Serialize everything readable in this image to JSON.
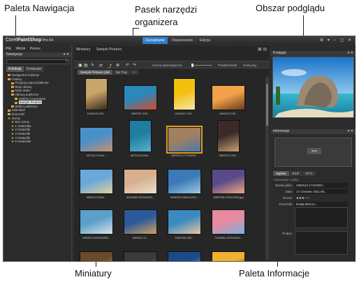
{
  "callouts": {
    "navigation": "Paleta Nawigacja",
    "toolbar_l1": "Pasek narzędzi",
    "toolbar_l2": "organizera",
    "preview": "Obszar podglądu",
    "thumbnails": "Miniatury",
    "info": "Paleta Informacje"
  },
  "app": {
    "title_prefix": "Corel",
    "title_main": "PaintShop",
    "title_suffix": " Pro X4",
    "modes": [
      "Zarządzanie",
      "Dopasowanie",
      "Edycja"
    ],
    "active_mode": "Zarządzanie"
  },
  "left_panel": {
    "menu": [
      "Plik",
      "Widok",
      "Pomoc"
    ],
    "header": "Nawigacja",
    "tabs": [
      "Kolekcje",
      "Komputer"
    ],
    "tree": [
      {
        "label": "Inteligentne kolekcje",
        "indent": 1,
        "icon": "folder"
      },
      {
        "label": "Foldery",
        "indent": 1,
        "icon": "folder"
      },
      {
        "label": "Przejrzyj więcej folderów",
        "indent": 2,
        "icon": "folder"
      },
      {
        "label": "Moje obrazy",
        "indent": 2,
        "icon": "folder"
      },
      {
        "label": "Moje wideo",
        "indent": 2,
        "icon": "folder"
      },
      {
        "label": "Obrazy publiczne",
        "indent": 2,
        "icon": "folder"
      },
      {
        "label": "AMD04 Corporation",
        "indent": 3,
        "icon": "folder"
      },
      {
        "label": "Sample Pictures",
        "indent": 3,
        "icon": "folder",
        "selected": true
      },
      {
        "label": "Wideo publiczne",
        "indent": 2,
        "icon": "folder"
      },
      {
        "label": "Kalendarz",
        "indent": 1,
        "icon": "folder"
      },
      {
        "label": "Znaczniki",
        "indent": 1,
        "icon": "folder"
      },
      {
        "label": "Oceny",
        "indent": 1,
        "icon": "star"
      },
      {
        "label": "Bez oceny",
        "indent": 2,
        "icon": "star"
      },
      {
        "label": "1 Gwiazdka",
        "indent": 2,
        "icon": "star"
      },
      {
        "label": "2 Gwiazdki",
        "indent": 2,
        "icon": "star"
      },
      {
        "label": "3 Gwiazdki",
        "indent": 2,
        "icon": "star"
      },
      {
        "label": "4 Gwiazdki",
        "indent": 2,
        "icon": "star"
      },
      {
        "label": "5 Gwiazdek",
        "indent": 2,
        "icon": "star"
      }
    ]
  },
  "center": {
    "breadcrumb": [
      "Miniatury",
      "Sample Pictures"
    ],
    "toolbar": {
      "auto_label": "Ocena automatyczna",
      "sort_label": "Powiększenie",
      "sort_value": "Sortuj wg"
    },
    "tabs": [
      "Sample Pictures (46)",
      "My Tray",
      "+"
    ],
    "thumbnails": [
      {
        "caption": "1030449-226...",
        "colors": [
          "#c8a56a",
          "#3b2a1c"
        ],
        "row": 0,
        "col": 0
      },
      {
        "caption": "3059337-225...",
        "colors": [
          "#2c88b8",
          "#d44a2a"
        ],
        "row": 0,
        "col": 1
      },
      {
        "caption": "4493427-219...",
        "colors": [
          "#f3c010",
          "#f6e6a4"
        ],
        "row": 0,
        "col": 2
      },
      {
        "caption": "4493427-239...",
        "colors": [
          "#f0a24a",
          "#6b3a1a"
        ],
        "row": 0,
        "col": 3
      },
      {
        "caption": "4573112-240e...",
        "colors": [
          "#4a90c8",
          "#c69070"
        ],
        "row": 1,
        "col": 0
      },
      {
        "caption": "4572116-240e...",
        "colors": [
          "#1f7da0",
          "#59b0c8"
        ],
        "row": 1,
        "col": 1
      },
      {
        "caption": "4593121-1712b255...",
        "colors": [
          "#a08060",
          "#4a7ab0"
        ],
        "row": 1,
        "col": 2,
        "selected": true
      },
      {
        "caption": "4593121-228...",
        "colors": [
          "#3b2a2a",
          "#c8a070"
        ],
        "row": 1,
        "col": 3
      },
      {
        "caption": "4593112-260e...",
        "colors": [
          "#6aa8d8",
          "#e0d0a0"
        ],
        "row": 2,
        "col": 0
      },
      {
        "caption": "5623068-1023x2393...",
        "colors": [
          "#d8b090",
          "#e8e0d0"
        ],
        "row": 2,
        "col": 1
      },
      {
        "caption": "5056153-256e1x229...",
        "colors": [
          "#3a7ab8",
          "#a0c8e0"
        ],
        "row": 2,
        "col": 2
      },
      {
        "caption": "5559758-1023x2300.jpg",
        "colors": [
          "#5a4a8a",
          "#f0a880"
        ],
        "row": 2,
        "col": 3
      },
      {
        "caption": "5383313-2003x2556...",
        "colors": [
          "#5aa0c8",
          "#d8e0e8"
        ],
        "row": 3,
        "col": 0
      },
      {
        "caption": "5383221-5...",
        "colors": [
          "#2a5a9a",
          "#d0a060"
        ],
        "row": 3,
        "col": 1
      },
      {
        "caption": "5383780-280...",
        "colors": [
          "#3a8ac0",
          "#e8c8a0"
        ],
        "row": 3,
        "col": 2
      },
      {
        "caption": "7440966-1023x2300...",
        "colors": [
          "#e88aa0",
          "#80b0d8"
        ],
        "row": 3,
        "col": 3
      },
      {
        "caption": "",
        "colors": [
          "#6a4a2a",
          "#e0b060"
        ],
        "row": 4,
        "col": 0
      },
      {
        "caption": "",
        "colors": [
          "#3a3a3a",
          "#7a6a5a"
        ],
        "row": 4,
        "col": 1
      },
      {
        "caption": "",
        "colors": [
          "#1a4a8a",
          "#c0d8f0"
        ],
        "row": 4,
        "col": 2
      },
      {
        "caption": "",
        "colors": [
          "#f0b030",
          "#603010"
        ],
        "row": 4,
        "col": 3
      }
    ]
  },
  "right_panel": {
    "preview_header": "Podgląd",
    "info_header": "Informacje",
    "info_chip": "JPG",
    "info_tabs": [
      "Ogólne",
      "EXIF",
      "IPTC"
    ],
    "info_section": "Informacje o pliku",
    "fields": [
      {
        "key": "Nazwa pliku:",
        "value": "4593121-17123257..."
      },
      {
        "key": "Data:",
        "value": "17 czerwiec 2011 08..."
      },
      {
        "key": "Ocena:",
        "value": "★★★☆☆"
      },
      {
        "key": "Znaczniki:",
        "value": "Dodaj tekst tu..."
      }
    ],
    "caption_label": "Podpis:"
  },
  "colors": {
    "accent": "#2f7fd0",
    "selection": "#e0a020",
    "star": "#e8c23a"
  }
}
